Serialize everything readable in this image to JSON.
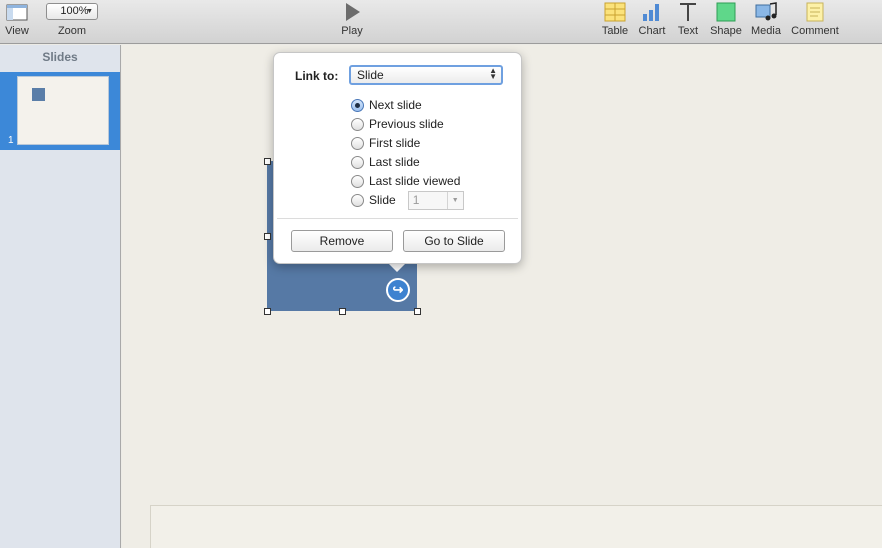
{
  "toolbar": {
    "view_label": "View",
    "zoom_value": "100%",
    "zoom_label": "Zoom",
    "play_label": "Play",
    "table_label": "Table",
    "chart_label": "Chart",
    "text_label": "Text",
    "shape_label": "Shape",
    "media_label": "Media",
    "comment_label": "Comment"
  },
  "sidebar": {
    "title": "Slides",
    "slides": [
      {
        "number": "1"
      }
    ]
  },
  "popover": {
    "link_to_label": "Link to:",
    "link_to_value": "Slide",
    "options": [
      {
        "label": "Next slide",
        "selected": true
      },
      {
        "label": "Previous slide",
        "selected": false
      },
      {
        "label": "First slide",
        "selected": false
      },
      {
        "label": "Last slide",
        "selected": false
      },
      {
        "label": "Last slide viewed",
        "selected": false
      },
      {
        "label": "Slide",
        "selected": false
      }
    ],
    "slide_number": "1",
    "remove_label": "Remove",
    "go_to_slide_label": "Go to Slide"
  },
  "colors": {
    "accent": "#3c88d8",
    "shape_fill": "#5679a5",
    "canvas": "#efede6"
  }
}
